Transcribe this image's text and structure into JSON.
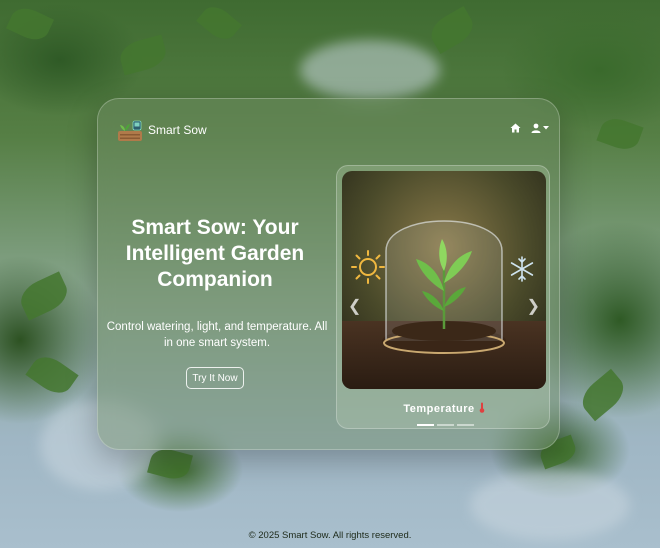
{
  "brand": {
    "name": "Smart Sow"
  },
  "nav": {
    "icons": [
      "home-icon",
      "user-icon",
      "caret-down-icon"
    ]
  },
  "hero": {
    "title": "Smart Sow: Your Intelligent Garden Companion",
    "description": "Control watering, light, and temperature. All in one smart system.",
    "cta_label": "Try It Now"
  },
  "carousel": {
    "active_caption": "Temperature",
    "caption_icon": "thermometer-icon",
    "slide_count": 3,
    "active_index": 0
  },
  "footer": {
    "text": "© 2025 Smart Sow. All rights reserved."
  },
  "colors": {
    "caption_icon": "#e04040",
    "text": "#ffffff"
  }
}
